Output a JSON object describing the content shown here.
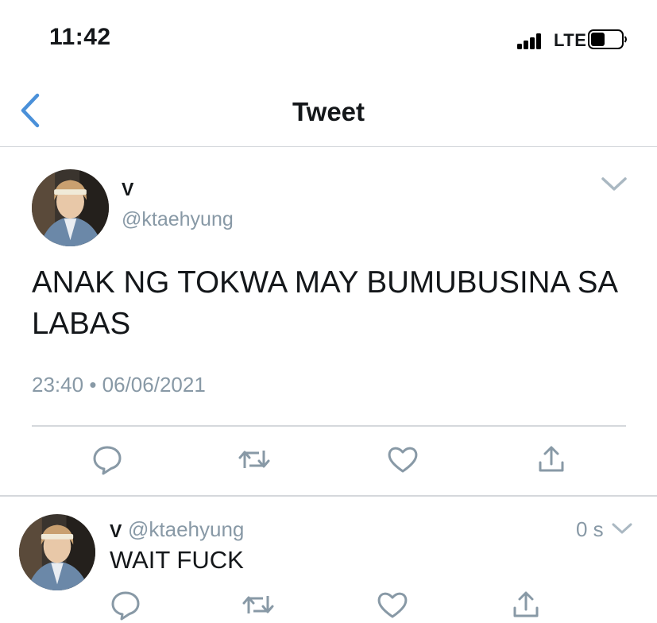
{
  "status_bar": {
    "time": "11:42",
    "network": "LTE"
  },
  "nav": {
    "title": "Tweet",
    "back_icon": "chevron-left-icon"
  },
  "tweet": {
    "display_name": "V",
    "handle": "@ktaehyung",
    "text": "ANAK NG TOKWA MAY BUMUBUSINA SA LABAS",
    "time": "23:40",
    "separator": "•",
    "date": "06/06/2021"
  },
  "reply": {
    "display_name": "V",
    "handle": "@ktaehyung",
    "text": "WAIT FUCK",
    "age": "0 s"
  },
  "actions": [
    "reply-icon",
    "retweet-icon",
    "like-icon",
    "share-icon"
  ],
  "colors": {
    "accent": "#4a90d9",
    "icon_gray": "#8899a6",
    "text": "#14171a",
    "muted": "#8899a6",
    "divider": "#d5d8dc"
  }
}
